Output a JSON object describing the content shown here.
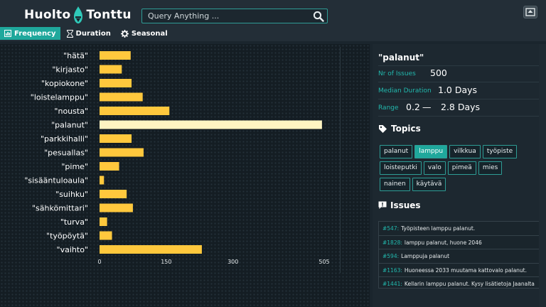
{
  "brand": {
    "name_left": "Huolto",
    "name_right": "Tonttu"
  },
  "search": {
    "placeholder": "Query Anything ..."
  },
  "tabs": [
    {
      "label": "Frequency",
      "icon": "bar-chart-icon",
      "active": true
    },
    {
      "label": "Duration",
      "icon": "hourglass-icon",
      "active": false
    },
    {
      "label": "Seasonal",
      "icon": "gear-icon",
      "active": false
    }
  ],
  "chart_data": {
    "type": "bar",
    "orientation": "horizontal",
    "categories": [
      "\"hätä\"",
      "\"kirjasto\"",
      "\"kopiokone\"",
      "\"loistelamppu\"",
      "\"nousta\"",
      "\"palanut\"",
      "\"parkkihalli\"",
      "\"pesuallas\"",
      "\"pime\"",
      "\"sisääntuloaula\"",
      "\"suihku\"",
      "\"sähkömittari\"",
      "\"turva\"",
      "\"työpöytä\"",
      "\"vaihto\""
    ],
    "values": [
      70,
      50,
      72,
      97,
      157,
      500,
      72,
      99,
      44,
      10,
      61,
      75,
      17,
      28,
      230
    ],
    "highlighted": "\"palanut\"",
    "xlim": [
      0,
      505
    ],
    "xticks": [
      "0",
      "150",
      "300",
      "505"
    ],
    "xtick_values": [
      0,
      150,
      300,
      505
    ],
    "bar_color": "#ffc83d",
    "highlight_color": "#fff4c2",
    "grid": false,
    "title": "",
    "xlabel": "",
    "ylabel": ""
  },
  "detail": {
    "title": "\"palanut\"",
    "issues_label": "Nr of Issues",
    "issues_value": "500",
    "median_label": "Median Duration",
    "median_value": "1.0 Days",
    "range_label": "Range",
    "range_low": "0.2",
    "range_sep": "—",
    "range_high": "2.8 Days",
    "topics_heading": "Topics",
    "topics": [
      {
        "label": "palanut",
        "active": false
      },
      {
        "label": "lamppu",
        "active": true
      },
      {
        "label": "vilkkua",
        "active": false
      },
      {
        "label": "työpiste",
        "active": false
      },
      {
        "label": "loisteputki",
        "active": false
      },
      {
        "label": "valo",
        "active": false
      },
      {
        "label": "pimeä",
        "active": false
      },
      {
        "label": "mies",
        "active": false
      },
      {
        "label": "nainen",
        "active": false
      },
      {
        "label": "käytävä",
        "active": false
      }
    ],
    "issues_heading": "Issues",
    "issues": [
      {
        "id": "#547:",
        "text": "Työpisteen lamppu palanut."
      },
      {
        "id": "#1828:",
        "text": "lamppu palanut, huone 2046"
      },
      {
        "id": "#594:",
        "text": "Lamppuja palanut"
      },
      {
        "id": "#1163:",
        "text": "Huoneessa 2033 muutama kattovalo palanut."
      },
      {
        "id": "#1441:",
        "text": "Kellarin lamppu palanut. Kysy lisätietoja Jaanalta"
      }
    ]
  },
  "colors": {
    "accent": "#1fa89c",
    "bar": "#ffc83d",
    "background": "#1a252d"
  }
}
